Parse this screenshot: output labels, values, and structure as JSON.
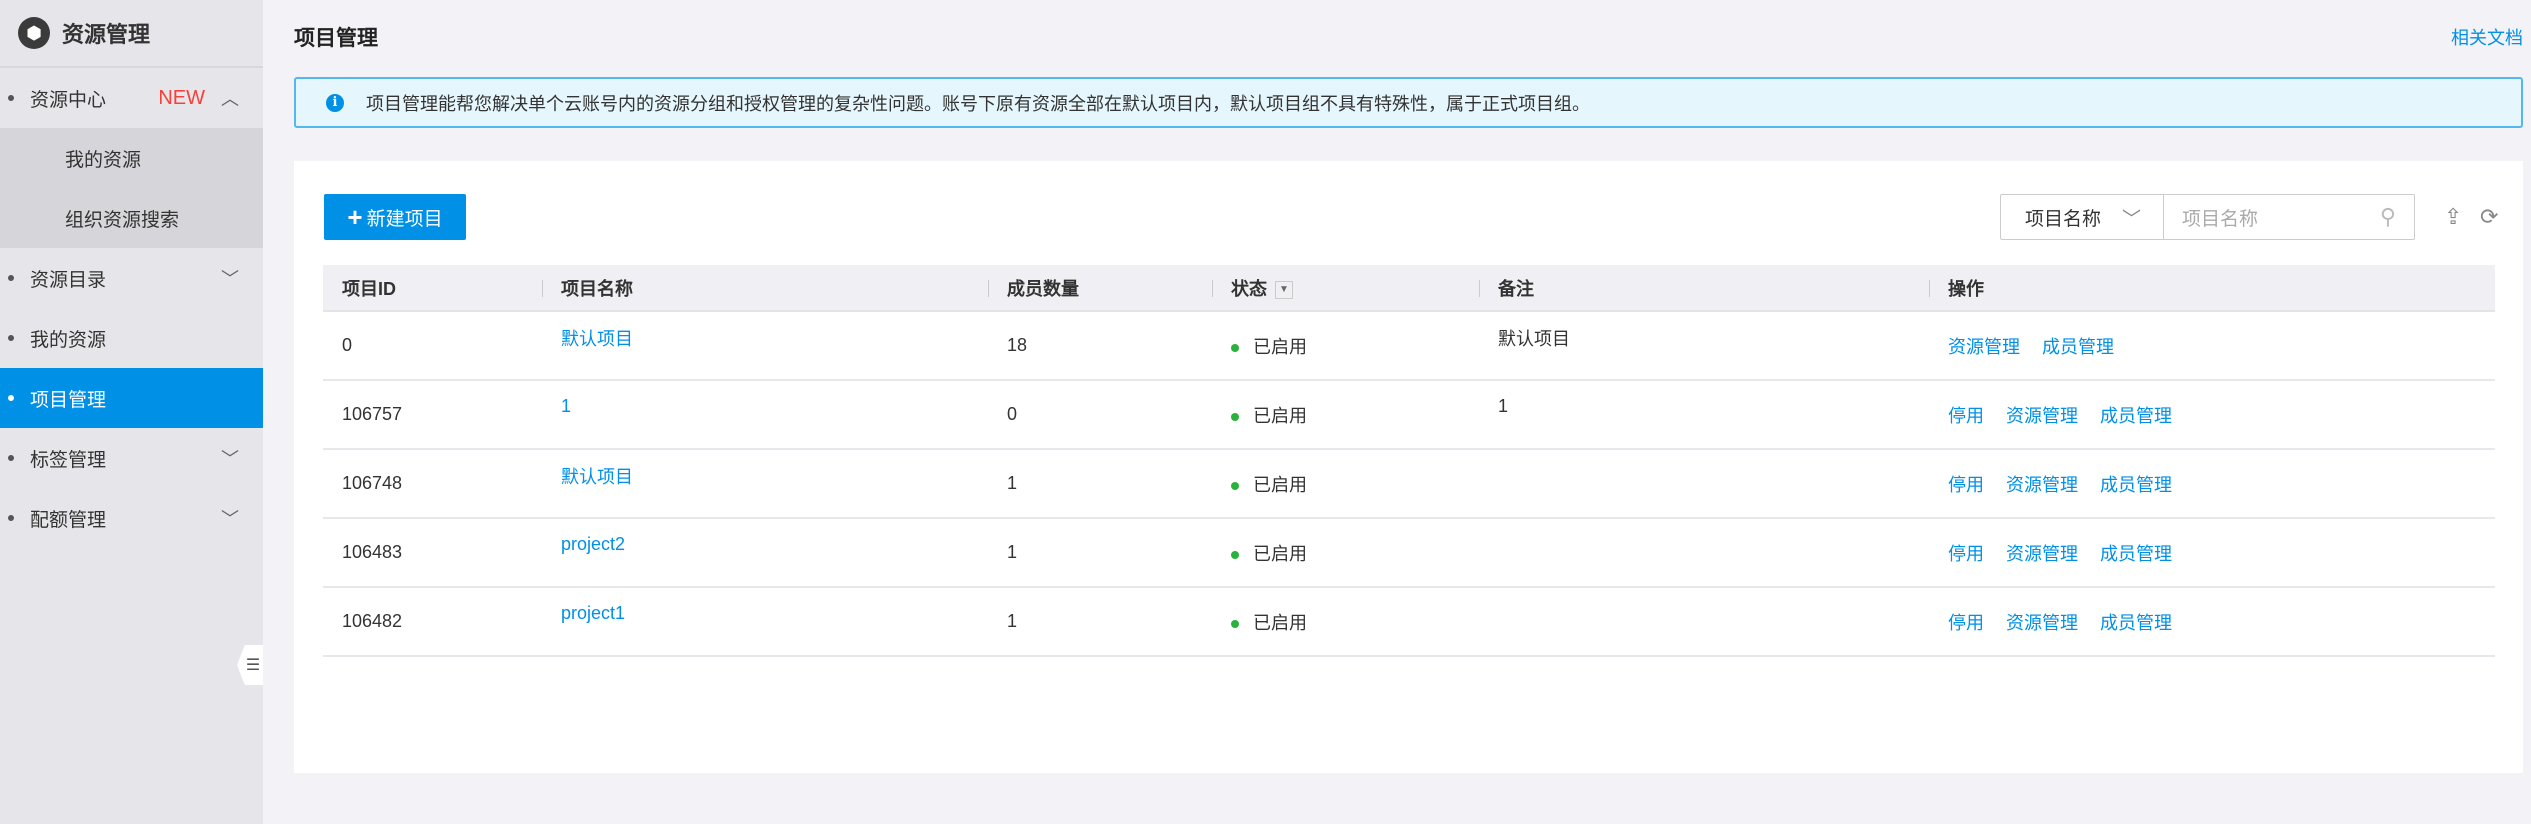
{
  "sidebar": {
    "title": "资源管理",
    "new_badge": "NEW",
    "items": [
      {
        "label": "资源中心"
      },
      {
        "label": "我的资源"
      },
      {
        "label": "组织资源搜索"
      },
      {
        "label": "资源目录"
      },
      {
        "label": "我的资源"
      },
      {
        "label": "项目管理"
      },
      {
        "label": "标签管理"
      },
      {
        "label": "配额管理"
      }
    ]
  },
  "header": {
    "title": "项目管理",
    "doc_link": "相关文档"
  },
  "info": "项目管理能帮您解决单个云账号内的资源分组和授权管理的复杂性问题。账号下原有资源全部在默认项目内，默认项目组不具有特殊性，属于正式项目组。",
  "toolbar": {
    "new_button": "新建项目",
    "search_field": "项目名称",
    "search_placeholder": "项目名称"
  },
  "table": {
    "columns": [
      "项目ID",
      "项目名称",
      "成员数量",
      "状态",
      "备注",
      "操作"
    ],
    "actions": {
      "disable": "停用",
      "resources": "资源管理",
      "members": "成员管理"
    },
    "rows": [
      {
        "id": "0",
        "name": "默认项目",
        "members": "18",
        "status": "已启用",
        "note": "默认项目"
      },
      {
        "id": "106757",
        "name": "1",
        "members": "0",
        "status": "已启用",
        "note": "1"
      },
      {
        "id": "106748",
        "name": "默认项目",
        "members": "1",
        "status": "已启用",
        "note": ""
      },
      {
        "id": "106483",
        "name": "project2",
        "members": "1",
        "status": "已启用",
        "note": ""
      },
      {
        "id": "106482",
        "name": "project1",
        "members": "1",
        "status": "已启用",
        "note": ""
      }
    ]
  },
  "colors": {
    "accent": "#0090e6",
    "status_ok": "#29b23c",
    "badge": "#f5413a"
  }
}
